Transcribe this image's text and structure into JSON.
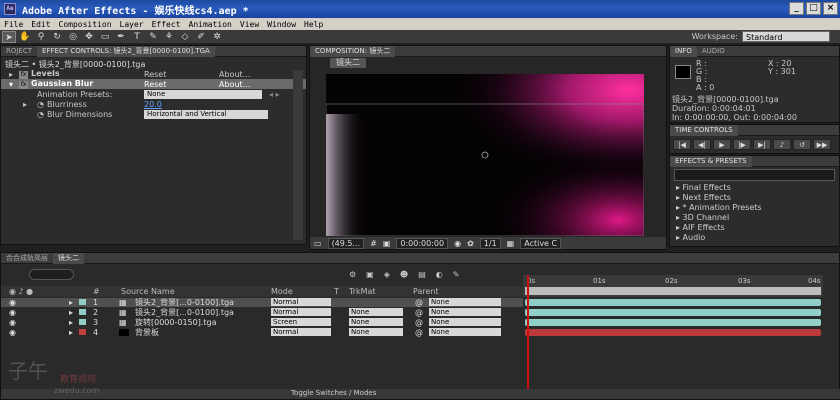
{
  "window": {
    "title": "Adobe After Effects - 娱乐快线cs4.aep *",
    "logo": "Ae"
  },
  "menu": [
    "File",
    "Edit",
    "Composition",
    "Layer",
    "Effect",
    "Animation",
    "View",
    "Window",
    "Help"
  ],
  "toolbar": {
    "workspace_label": "Workspace:",
    "workspace_value": "Standard"
  },
  "effect_controls": {
    "tab_project": "ROJECT",
    "tab_title": "EFFECT CONTROLS: 镜头2_背景[0000-0100].tga",
    "layer_path": "镜头二 • 镜头2_背景[0000-0100].tga",
    "levels": {
      "name": "Levels",
      "reset": "Reset",
      "about": "About..."
    },
    "gaussian": {
      "name": "Gaussian Blur",
      "reset": "Reset",
      "about": "About..."
    },
    "presets_label": "Animation Presets:",
    "presets_value": "None",
    "blurriness_label": "Blurriness",
    "blurriness_value": "20.0",
    "blur_dim_label": "Blur Dimensions",
    "blur_dim_value": "Horizontal and Vertical"
  },
  "composition": {
    "tab_title": "COMPOSITION: 镜头二",
    "chip": "镜头二",
    "zoom": "(49.5...",
    "timecode": "0:00:00:00",
    "resolution": "1/1",
    "camera": "Active C"
  },
  "info": {
    "tab_info": "INFO",
    "tab_audio": "AUDIO",
    "r": "R :",
    "g": "G :",
    "b": "B :",
    "a": "A : 0",
    "x": "X : 20",
    "y": "Y : 301",
    "file": "镜头2_背景[0000-0100].tga",
    "duration": "Duration: 0:00:04:01",
    "inout": "In: 0:00:00:00, Out: 0:00:04:00"
  },
  "time_controls": {
    "title": "TIME CONTROLS"
  },
  "effects_presets": {
    "title": "EFFECTS & PRESETS",
    "items": [
      "▸ Final Effects",
      "▸ Next Effects",
      "▸ * Animation Presets",
      "▸ 3D Channel",
      "▸ AIF Effects",
      "▸ Audio"
    ]
  },
  "timeline": {
    "tab1": "合合成轨简层",
    "tab2": "镜头二",
    "headers": {
      "num": "#",
      "source": "Source Name",
      "mode": "Mode",
      "t": "T",
      "trkmat": "TrkMat",
      "parent": "Parent"
    },
    "ruler": [
      "0s",
      "01s",
      "02s",
      "03s",
      "04s"
    ],
    "layers": [
      {
        "num": "1",
        "name": "镜头2_背景[...0-0100].tga",
        "mode": "Normal",
        "trkmat": "",
        "parent": "None",
        "label_color": "#8fcfc8",
        "track_color": "#8fcfc8"
      },
      {
        "num": "2",
        "name": "镜头2_背景[...0-0100].tga",
        "mode": "Normal",
        "trkmat": "None",
        "parent": "None",
        "label_color": "#8fcfc8",
        "track_color": "#8fcfc8"
      },
      {
        "num": "3",
        "name": "旋转[0000-0150].tga",
        "mode": "Screen",
        "trkmat": "None",
        "parent": "None",
        "label_color": "#8fcfc8",
        "track_color": "#8fcfc8"
      },
      {
        "num": "4",
        "name": "背景板",
        "mode": "Normal",
        "trkmat": "None",
        "parent": "None",
        "label_color": "#c04040",
        "track_color": "#b83a3a"
      }
    ],
    "toggle": "Toggle Switches / Modes"
  },
  "watermark": {
    "big": "子午",
    "red": "教育视频",
    "small": "zwedu.com"
  },
  "colors": {
    "title_bar": "#2a5bbd",
    "playhead": "#d01010",
    "accent_blue": "#5fa3ff"
  }
}
